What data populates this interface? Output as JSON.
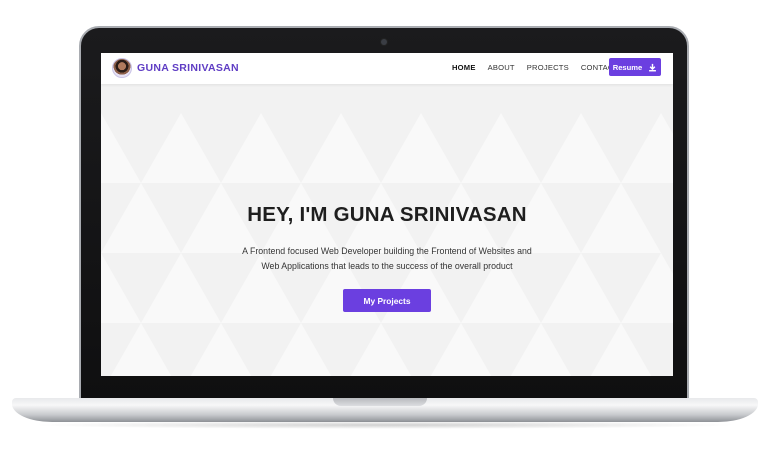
{
  "header": {
    "brand_name": "GUNA SRINIVASAN",
    "avatar_icon": "profile-photo"
  },
  "nav": {
    "items": [
      {
        "label": "HOME",
        "active": true
      },
      {
        "label": "ABOUT",
        "active": false
      },
      {
        "label": "PROJECTS",
        "active": false
      },
      {
        "label": "CONTACT",
        "active": false
      }
    ],
    "resume_label": "Resume",
    "resume_icon": "download-icon"
  },
  "hero": {
    "title": "HEY, I'M GUNA SRINIVASAN",
    "description_line1": "A Frontend focused Web Developer building the Frontend of Websites and",
    "description_line2": "Web Applications that leads to the success of the overall product",
    "cta_label": "My Projects"
  },
  "colors": {
    "accent": "#6b3fe0",
    "brand_text": "#5f3dc4",
    "hero_bg": "#f2f2f2"
  }
}
